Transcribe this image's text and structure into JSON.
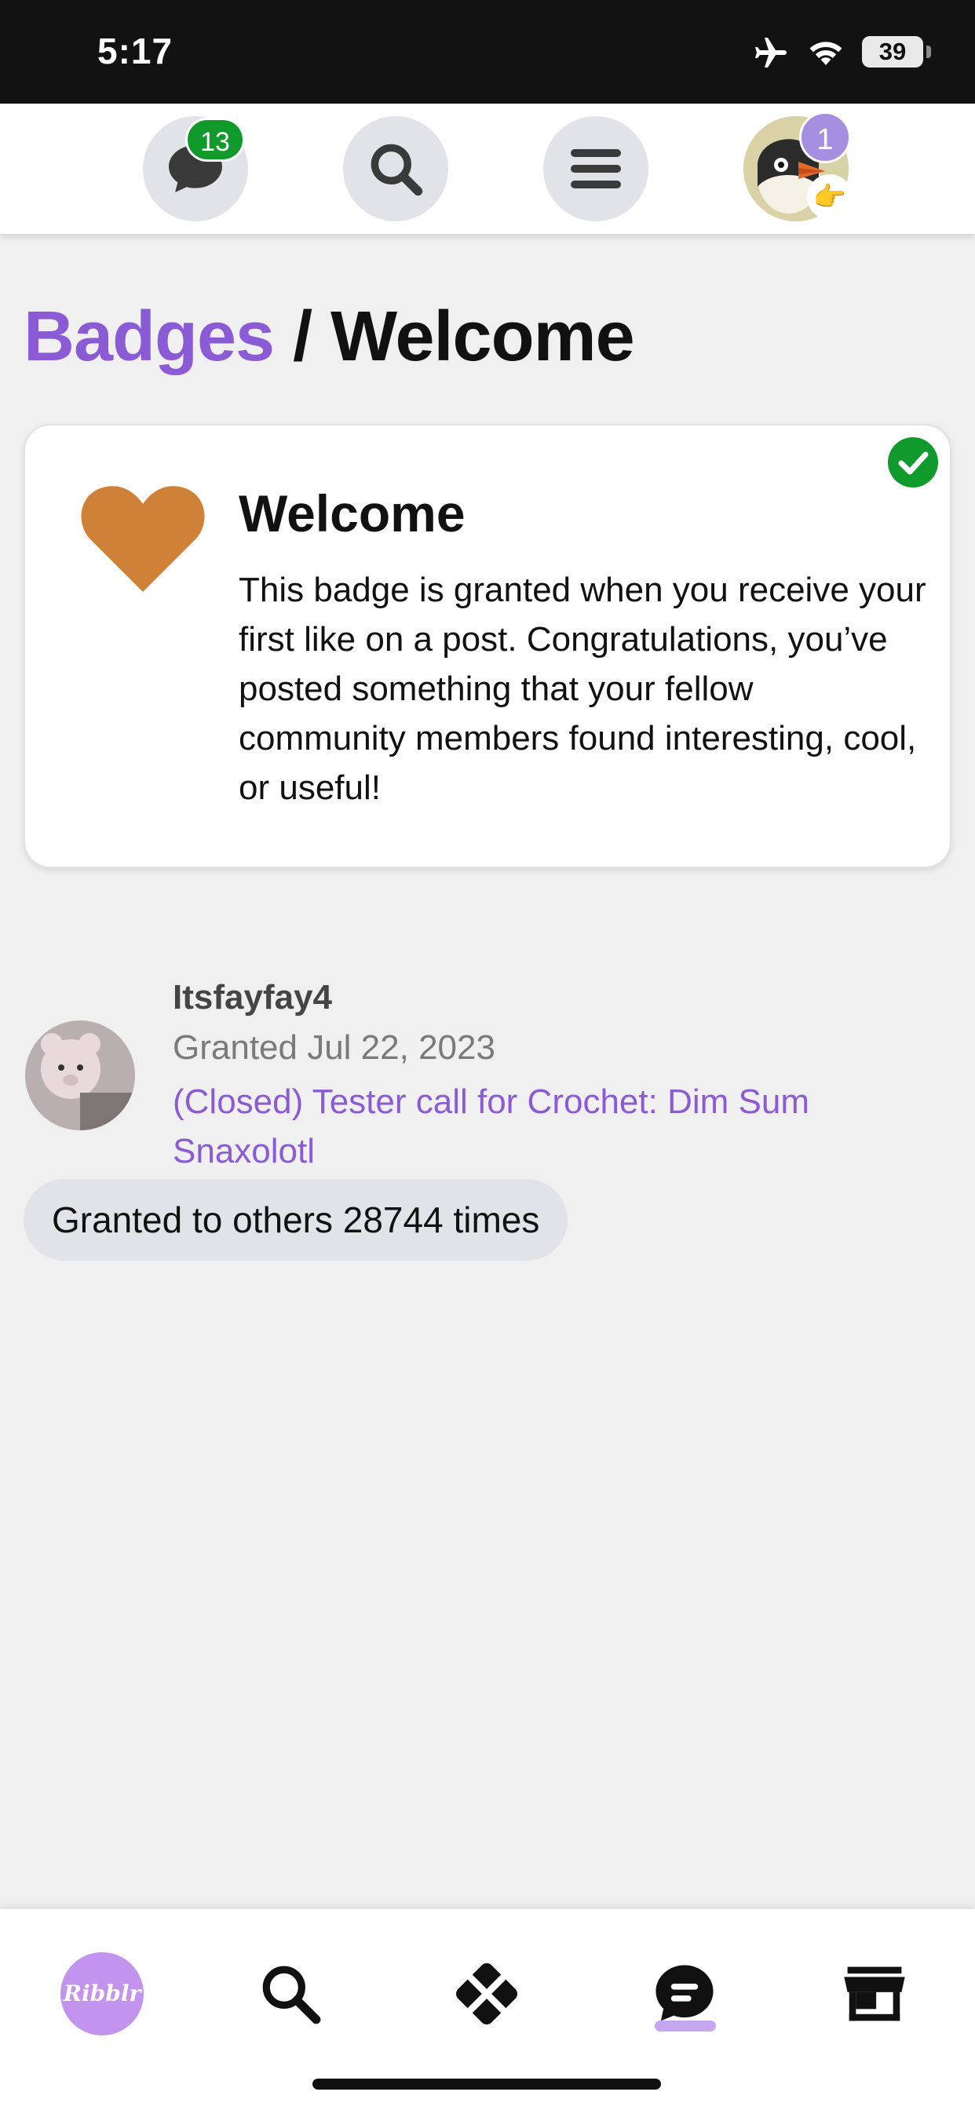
{
  "status_bar": {
    "time": "5:17",
    "battery": "39"
  },
  "header": {
    "chat_count": "13",
    "notification_count": "1"
  },
  "breadcrumb": {
    "parent": "Badges",
    "separator": "/",
    "current": "Welcome"
  },
  "badge": {
    "title": "Welcome",
    "description": "This badge is granted when you receive your first like on a post. Congratulations, you’ve posted something that your fellow community members found interesting, cool, or useful!",
    "icon": "heart-icon",
    "icon_color": "#cf8237",
    "granted_check_color": "#0f9a2b"
  },
  "grant": {
    "username": "Itsfayfay4",
    "granted_date": "Granted Jul 22, 2023",
    "post_link": "(Closed) Tester call for Crochet: Dim Sum Snaxolotl",
    "others_count": "Granted to others 28744 times"
  },
  "tabbar": {
    "logo_text": "Ribblr",
    "tabs": [
      "home",
      "search",
      "patterns",
      "community",
      "shop"
    ],
    "active": "community",
    "accent": "#c5a6ef"
  }
}
